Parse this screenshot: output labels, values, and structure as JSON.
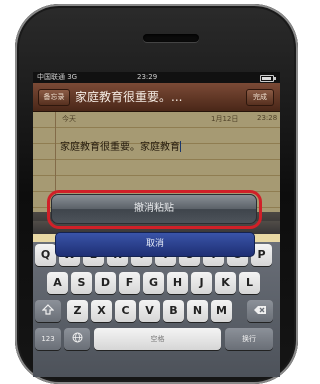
{
  "status_bar": {
    "carrier": "中国联通 3G",
    "time": "23:29"
  },
  "nav": {
    "back_label": "备忘录",
    "title": "家庭教育很重要。...",
    "done_label": "完成"
  },
  "note": {
    "day": "今天",
    "date": "1月12日",
    "time": "23:28",
    "text": "家庭教育很重要。家庭教育"
  },
  "action_sheet": {
    "undo_label": "撤消粘贴",
    "cancel_label": "取消"
  },
  "keyboard": {
    "row1": [
      "Q",
      "W",
      "E",
      "R",
      "T",
      "Y",
      "U",
      "I",
      "O",
      "P"
    ],
    "row2": [
      "A",
      "S",
      "D",
      "F",
      "G",
      "H",
      "J",
      "K",
      "L"
    ],
    "row3": [
      "Z",
      "X",
      "C",
      "V",
      "B",
      "N",
      "M"
    ],
    "numbers_label": "123",
    "space_label": "空格",
    "return_label": "换行",
    "shift_icon": "shift-icon",
    "delete_icon": "delete-icon",
    "globe_icon": "globe-icon"
  },
  "colors": {
    "highlight": "#d02028",
    "cancel_button": "#2a3f90",
    "paper": "#f0e2ad",
    "nav_bar": "#5e3423"
  }
}
